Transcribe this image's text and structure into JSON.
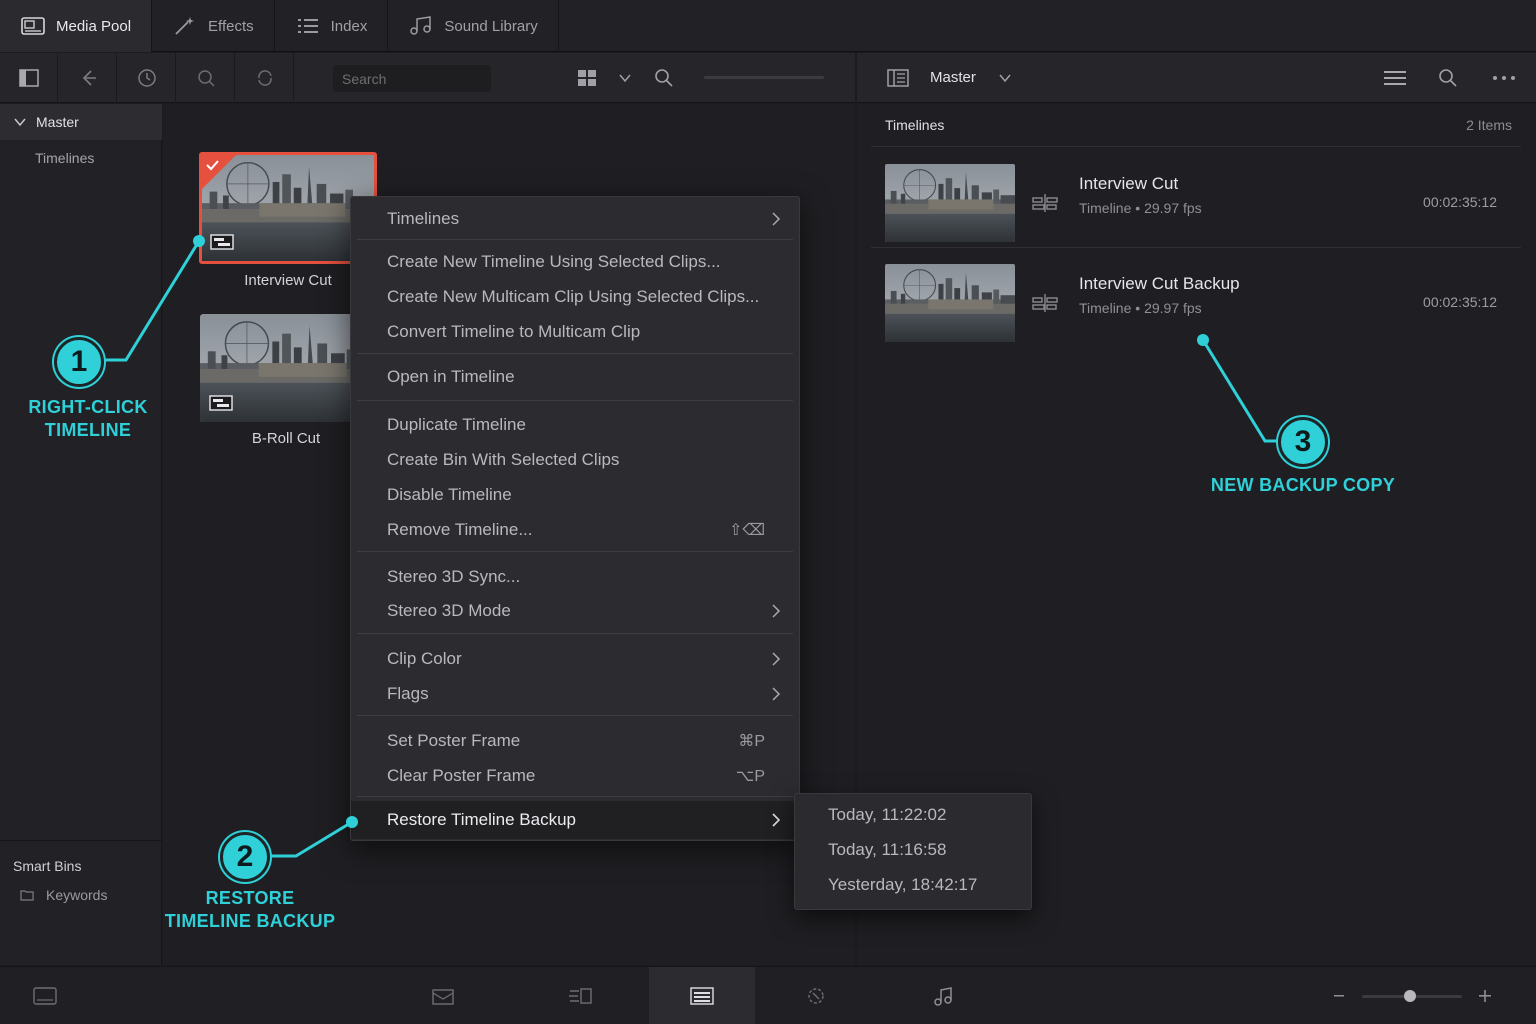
{
  "top_tabs": [
    {
      "label": "Media Pool",
      "icon": "media-pool-icon"
    },
    {
      "label": "Effects",
      "icon": "magic-wand-icon"
    },
    {
      "label": "Index",
      "icon": "list-icon"
    },
    {
      "label": "Sound Library",
      "icon": "music-notes-icon"
    }
  ],
  "toolbar": {
    "search_placeholder": "Search",
    "bin_label": "Master"
  },
  "sidebar": {
    "master": "Master",
    "sub_bin": "Timelines",
    "smart_bins": "Smart Bins",
    "keywords": "Keywords"
  },
  "clips": [
    {
      "name": "Interview Cut",
      "selected": true
    },
    {
      "name": "B-Roll Cut",
      "selected": false
    }
  ],
  "right_panel": {
    "heading": "Timelines",
    "count": "2 Items",
    "rows": [
      {
        "name": "Interview Cut",
        "meta": "Timeline • 29.97 fps",
        "duration": "00:02:35:12"
      },
      {
        "name": "Interview Cut Backup",
        "meta": "Timeline • 29.97 fps",
        "duration": "00:02:35:12"
      }
    ]
  },
  "context_menu": {
    "items": [
      {
        "label": "Timelines",
        "submenu": true
      },
      {
        "label": "Create New Timeline Using Selected Clips..."
      },
      {
        "label": "Create New Multicam Clip Using Selected Clips..."
      },
      {
        "label": "Convert Timeline to Multicam Clip"
      },
      {
        "label": "Open in Timeline"
      },
      {
        "label": "Duplicate Timeline"
      },
      {
        "label": "Create Bin With Selected Clips"
      },
      {
        "label": "Disable Timeline"
      },
      {
        "label": "Remove Timeline...",
        "shortcut": "⇧⌫"
      },
      {
        "label": "Stereo 3D Sync..."
      },
      {
        "label": "Stereo 3D Mode",
        "submenu": true
      },
      {
        "label": "Clip Color",
        "submenu": true
      },
      {
        "label": "Flags",
        "submenu": true
      },
      {
        "label": "Set Poster Frame",
        "shortcut": "⌘P"
      },
      {
        "label": "Clear Poster Frame",
        "shortcut": "⌥P"
      },
      {
        "label": "Restore Timeline Backup",
        "submenu": true,
        "highlighted": true
      }
    ]
  },
  "backup_submenu": [
    "Today, 11:22:02",
    "Today, 11:16:58",
    "Yesterday, 18:42:17"
  ],
  "annotations": [
    {
      "number": "1",
      "text_line1": "RIGHT-CLICK",
      "text_line2": "TIMELINE"
    },
    {
      "number": "2",
      "text_line1": "RESTORE",
      "text_line2": "TIMELINE BACKUP"
    },
    {
      "number": "3",
      "text_line1": "NEW BACKUP COPY",
      "text_line2": ""
    }
  ],
  "colors": {
    "accent_annotation": "#2fd0d8",
    "selection_red": "#e5503f"
  },
  "bottom_pages": [
    "media-page-icon",
    "cut-page-icon",
    "edit-page-icon",
    "fusion-page-icon",
    "color-page-icon",
    "fairlight-page-icon"
  ]
}
